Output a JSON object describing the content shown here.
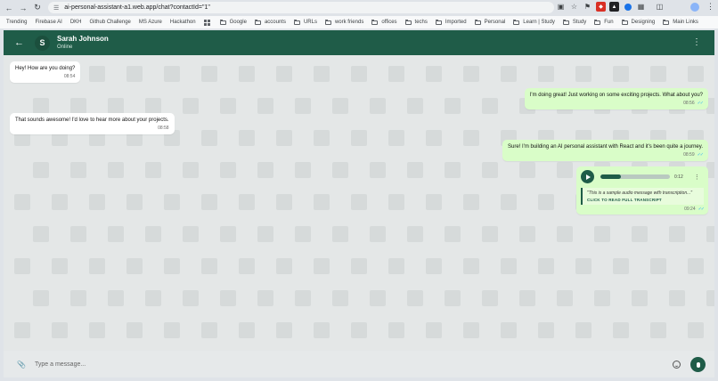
{
  "browser": {
    "url": "ai-personal-assistant-a1.web.app/chat?contactId=\"1\"",
    "bookmarks": [
      "Trending",
      "Firebase AI",
      "DKH",
      "Github Challenge",
      "MS Azure",
      "Hackathon"
    ],
    "folders": [
      "Google",
      "accounts",
      "URLs",
      "work friends",
      "offices",
      "techs",
      "Imported",
      "Personal",
      "Learn | Study",
      "Study",
      "Fun",
      "Designing",
      "Main Links"
    ]
  },
  "header": {
    "avatar_initial": "S",
    "contact_name": "Sarah Johnson",
    "status": "Online"
  },
  "messages": [
    {
      "direction": "in",
      "text": "Hey! How are you doing?",
      "time": "08:54"
    },
    {
      "direction": "out",
      "text": "I'm doing great! Just working on some exciting projects. What about you?",
      "time": "08:56",
      "read": true
    },
    {
      "direction": "in",
      "text": "That sounds awesome! I'd love to hear more about your projects.",
      "time": "08:58"
    },
    {
      "direction": "out",
      "text": "Sure! I'm building an AI personal assistant with React and it's been quite a journey.",
      "time": "08:59",
      "read": true
    }
  ],
  "audio_message": {
    "duration": "0:12",
    "progress": 0.3,
    "transcript": "\"This is a sample audio message with transcription...\"",
    "transcript_link": "CLICK TO READ FULL TRANSCRIPT",
    "time": "09:24",
    "read": true
  },
  "composer": {
    "placeholder": "Type a message..."
  },
  "colors": {
    "header": "#1f5c48",
    "outgoing_bubble": "#d9fdc8",
    "incoming_bubble": "#ffffff",
    "read_ticks": "#34b7f1"
  }
}
